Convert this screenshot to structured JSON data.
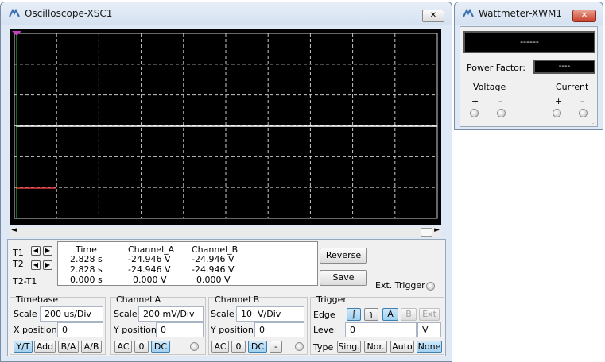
{
  "oscilloscope": {
    "title": "Oscilloscope-XSC1",
    "close_label": "✕",
    "cursor_rows": [
      {
        "label": "T1",
        "time": "2.828 s",
        "channel_a": "-24.946 V",
        "channel_b": "-24.946 V"
      },
      {
        "label": "T2",
        "time": "2.828 s",
        "channel_a": "-24.946 V",
        "channel_b": "-24.946 V"
      },
      {
        "label": "T2-T1",
        "time": "0.000 s",
        "channel_a": "0.000 V",
        "channel_b": "0.000 V"
      }
    ],
    "headers": {
      "time": "Time",
      "channel_a": "Channel_A",
      "channel_b": "Channel_B"
    },
    "reverse_label": "Reverse",
    "save_label": "Save",
    "ext_trigger_label": "Ext. Trigger",
    "timebase": {
      "title": "Timebase",
      "scale_label": "Scale",
      "scale_value": "200 us/Div",
      "xpos_label": "X position",
      "xpos_value": "0",
      "modes": [
        "Y/T",
        "Add",
        "B/A",
        "A/B"
      ],
      "active_mode": "Y/T"
    },
    "channel_a": {
      "title": "Channel A",
      "scale_label": "Scale",
      "scale_value": "200 mV/Div",
      "ypos_label": "Y position",
      "ypos_value": "0",
      "coupling": [
        "AC",
        "0",
        "DC"
      ],
      "active": "DC"
    },
    "channel_b": {
      "title": "Channel B",
      "scale_label": "Scale",
      "scale_value": "10  V/Div",
      "ypos_label": "Y position",
      "ypos_value": "0",
      "coupling": [
        "AC",
        "0",
        "DC",
        "-"
      ],
      "active": "DC"
    },
    "trigger": {
      "title": "Trigger",
      "edge_label": "Edge",
      "sources": [
        "A",
        "B",
        "Ext"
      ],
      "active_source": "A",
      "level_label": "Level",
      "level_value": "0",
      "level_unit": "V",
      "type_label": "Type",
      "types": [
        "Sing.",
        "Nor.",
        "Auto",
        "None"
      ],
      "active_type": "None"
    },
    "colors": {
      "screen": "#000000",
      "grid": "#d0d0d0",
      "trace_b": "#ffffff",
      "trace_a": "#e03a3a"
    }
  },
  "wattmeter": {
    "title": "Wattmeter-XWM1",
    "close_label": "✕",
    "display_value": "------",
    "power_factor_label": "Power Factor:",
    "power_factor_value": "----",
    "voltage_label": "Voltage",
    "current_label": "Current",
    "plus": "+",
    "minus": "–"
  }
}
